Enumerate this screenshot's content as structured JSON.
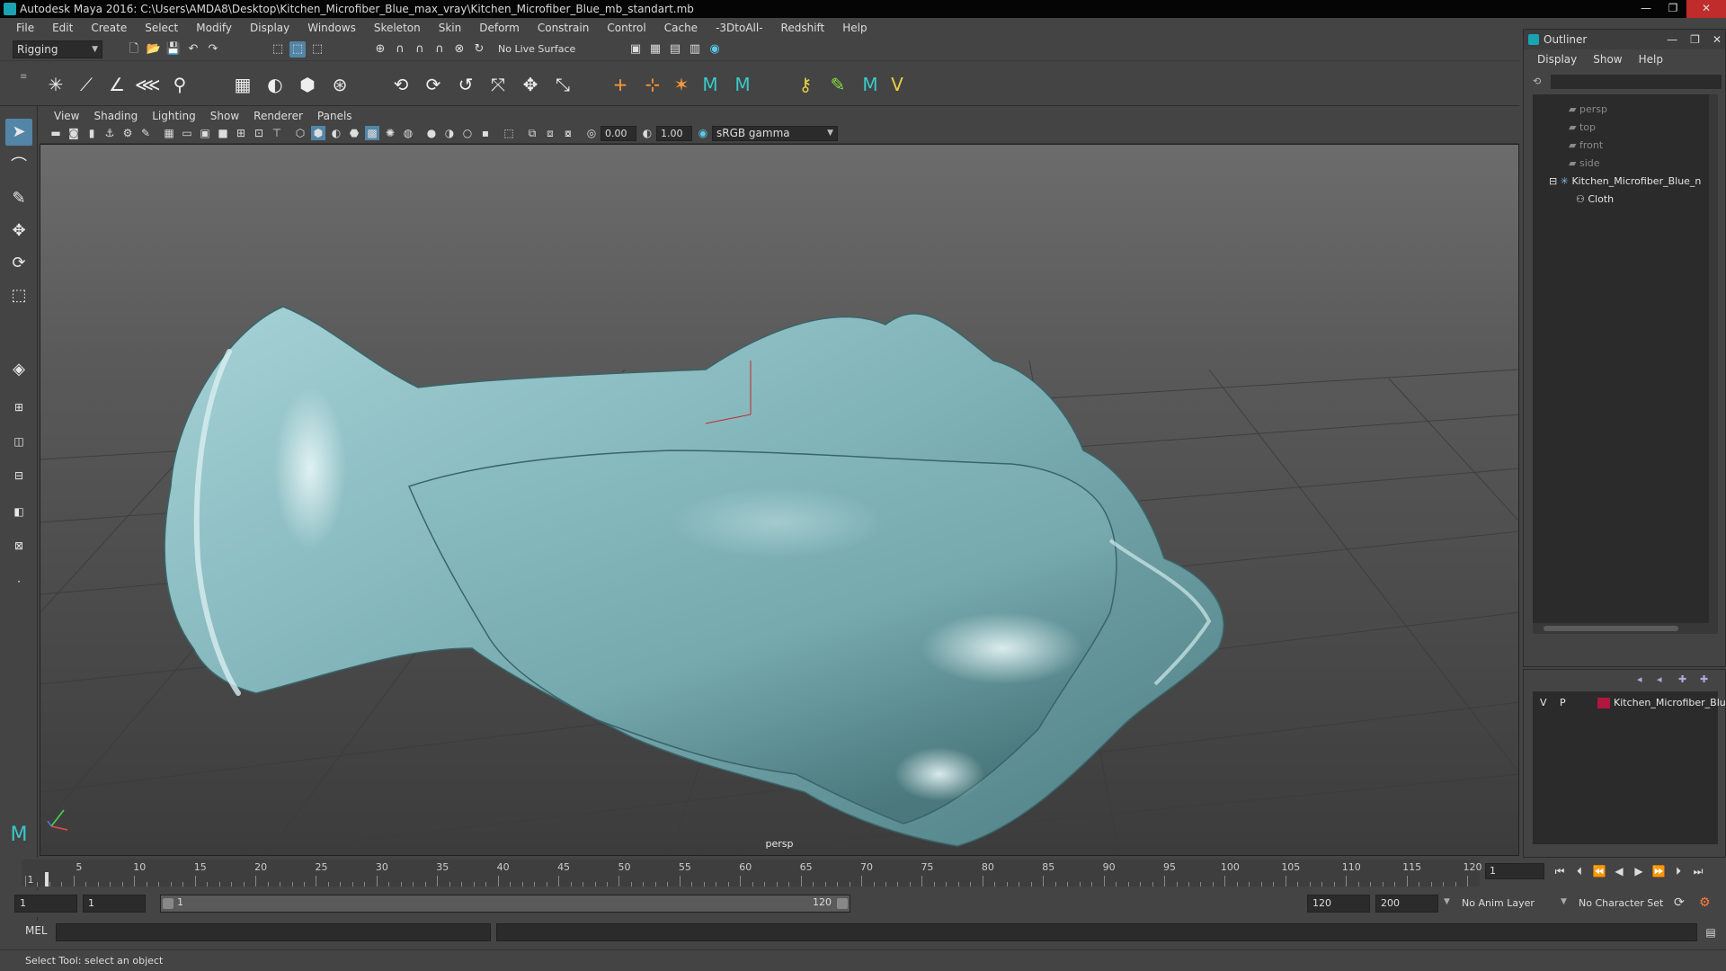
{
  "window": {
    "title": "Autodesk Maya 2016: C:\\Users\\AMDA8\\Desktop\\Kitchen_Microfiber_Blue_max_vray\\Kitchen_Microfiber_Blue_mb_standart.mb",
    "minimize": "—",
    "maximize": "❐",
    "close": "✕"
  },
  "menubar": [
    "File",
    "Edit",
    "Create",
    "Select",
    "Modify",
    "Display",
    "Windows",
    "Skeleton",
    "Skin",
    "Deform",
    "Constrain",
    "Control",
    "Cache",
    "-3DtoAll-",
    "Redshift",
    "Help"
  ],
  "statusline": {
    "menuset": "Rigging",
    "live_surface": "No Live Surface"
  },
  "panel": {
    "menus": [
      "View",
      "Shading",
      "Lighting",
      "Show",
      "Renderer",
      "Panels"
    ],
    "exposure": "0.00",
    "gamma": "1.00",
    "color_space": "sRGB gamma",
    "camera_label": "persp"
  },
  "outliner": {
    "title": "Outliner",
    "menus": [
      "Display",
      "Show",
      "Help"
    ],
    "items": [
      {
        "label": "persp",
        "dim": true
      },
      {
        "label": "top",
        "dim": true
      },
      {
        "label": "front",
        "dim": true
      },
      {
        "label": "side",
        "dim": true
      },
      {
        "label": "Kitchen_Microfiber_Blue_n",
        "dim": false
      },
      {
        "label": "Cloth",
        "dim": false
      }
    ]
  },
  "layers": {
    "visible": "V",
    "playback": "P",
    "layer_name": "Kitchen_Microfiber_Blu",
    "layer_color": "#b0173c"
  },
  "timeslider": {
    "ticks": [
      "1",
      "5",
      "10",
      "15",
      "20",
      "25",
      "30",
      "35",
      "40",
      "45",
      "50",
      "55",
      "60",
      "65",
      "70",
      "75",
      "80",
      "85",
      "90",
      "95",
      "100",
      "105",
      "110",
      "115",
      "120"
    ],
    "current_frame": "1"
  },
  "range": {
    "start": "1",
    "anim_start": "1",
    "range_start_label": "1",
    "range_end_label": "120",
    "anim_end": "120",
    "end": "200",
    "anim_layer": "No Anim Layer",
    "char_set": "No Character Set"
  },
  "cmdline": {
    "lang": "MEL"
  },
  "helpline": {
    "text": "Select Tool: select an object"
  },
  "colors": {
    "cloth": "#7fb3b8",
    "accent": "#5285a6"
  }
}
